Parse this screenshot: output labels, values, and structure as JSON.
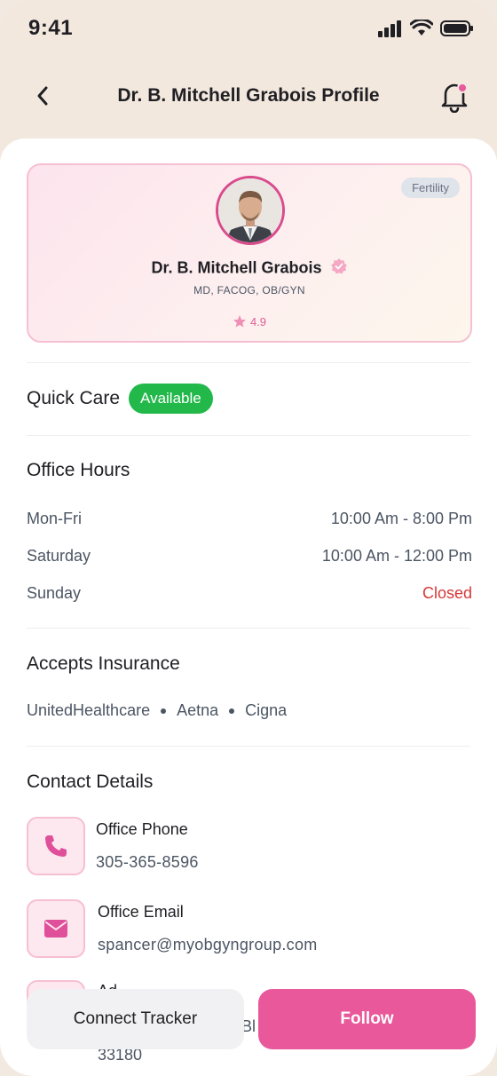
{
  "status_bar": {
    "time": "9:41"
  },
  "header": {
    "title": "Dr. B. Mitchell Grabois Profile"
  },
  "profile": {
    "specialty_badge": "Fertility",
    "name": "Dr. B. Mitchell Grabois",
    "credentials": "MD, FACOG, OB/GYN",
    "rating": "4.9"
  },
  "quick_care": {
    "label": "Quick Care",
    "status": "Available"
  },
  "office_hours": {
    "title": "Office Hours",
    "rows": [
      {
        "day": "Mon-Fri",
        "hours": "10:00 Am - 8:00 Pm"
      },
      {
        "day": "Saturday",
        "hours": "10:00 Am - 12:00 Pm"
      },
      {
        "day": "Sunday",
        "hours": "Closed"
      }
    ]
  },
  "insurance": {
    "title": "Accepts Insurance",
    "providers": [
      "UnitedHealthcare",
      "Aetna",
      "Cigna"
    ]
  },
  "contact": {
    "title": "Contact Details",
    "phone_label": "Office Phone",
    "phone_value": "305-365-8596",
    "email_label": "Office Email",
    "email_value": "spancer@myobgyngroup.com",
    "address_label_partial": "Ad",
    "address_partial": "Bl",
    "address_zip": "33180"
  },
  "actions": {
    "connect_label": "Connect Tracker",
    "follow_label": "Follow"
  },
  "colors": {
    "accent": "#e8589a",
    "available": "#22b84a",
    "closed": "#d63838"
  }
}
